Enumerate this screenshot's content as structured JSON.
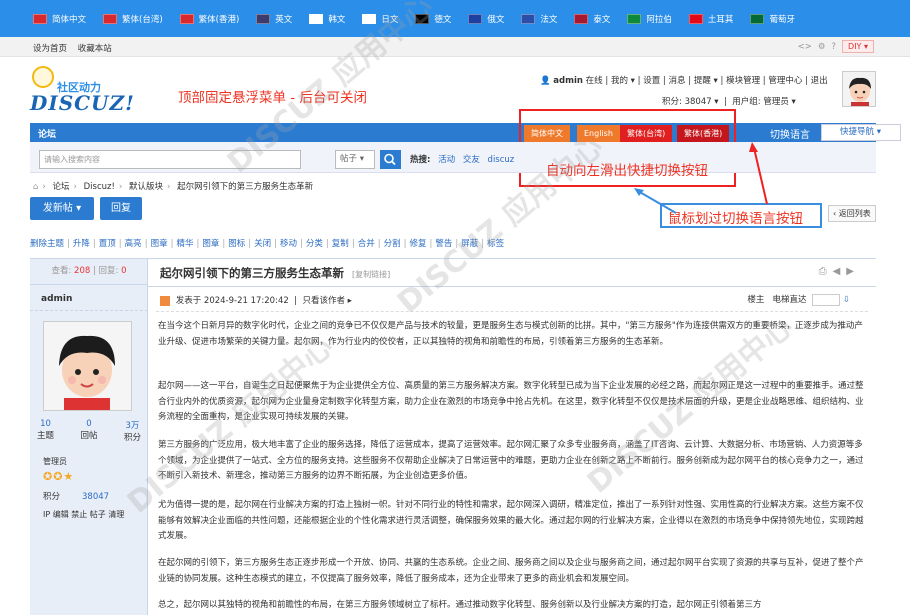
{
  "lang_bar": {
    "items": [
      {
        "label": "简体中文",
        "flag": "#d8292f"
      },
      {
        "label": "繁体(台湾)",
        "flag": "#d8292f"
      },
      {
        "label": "繁体(香港)",
        "flag": "#d8292f"
      },
      {
        "label": "英文",
        "flag": "#3c3b6e"
      },
      {
        "label": "韩文",
        "flag": "#ffffff"
      },
      {
        "label": "日文",
        "flag": "#ffffff"
      },
      {
        "label": "德文",
        "flag": "#000000"
      },
      {
        "label": "俄文",
        "flag": "#1c3fa0"
      },
      {
        "label": "法文",
        "flag": "#2b4fa8"
      },
      {
        "label": "泰文",
        "flag": "#a51931"
      },
      {
        "label": "阿拉伯",
        "flag": "#0f8a3c"
      },
      {
        "label": "土耳其",
        "flag": "#e30a17"
      },
      {
        "label": "葡萄牙",
        "flag": "#046a38"
      }
    ]
  },
  "top_links": {
    "home": "设为首页",
    "favorite": "收藏本站",
    "diy": "DIY"
  },
  "logo": {
    "cn": "社区动力",
    "en": "DISCUZ!"
  },
  "annotations": {
    "fixed_menu": "顶部固定悬浮菜单 - 后台可关闭",
    "slide": "自动向左滑出快捷切换按钮",
    "hover": "鼠标划过切换语言按钮"
  },
  "user": {
    "name": "admin",
    "status": "在线",
    "links": [
      "我的",
      "设置",
      "消息",
      "提醒",
      "模块管理",
      "管理中心",
      "退出"
    ],
    "points_label": "积分: 38047",
    "group_label": "用户组: 管理员"
  },
  "nav": {
    "forum": "论坛",
    "lang_buttons": [
      {
        "label": "简体中文",
        "color": "#f07a2b"
      },
      {
        "label": "English",
        "color": "#f07a2b"
      },
      {
        "label": "繁体(台湾)",
        "color": "#e02020"
      },
      {
        "label": "繁体(香港)",
        "color": "#c4161c"
      }
    ],
    "switch_label": "切换语言",
    "quick_nav": "快捷导航"
  },
  "search": {
    "placeholder": "请输入搜索内容",
    "type": "帖子",
    "hot_label": "热搜:",
    "hot_terms": [
      "活动",
      "交友",
      "discuz"
    ]
  },
  "breadcrumb": [
    "论坛",
    "Discuz!",
    "默认版块",
    "起尔网引领下的第三方服务生态革新"
  ],
  "actions": {
    "new_post": "发新帖",
    "reply": "回复",
    "back_list": "返回列表"
  },
  "admin_tools": [
    "删除主题",
    "升降",
    "置顶",
    "高亮",
    "图章",
    "精华",
    "图章",
    "图标",
    "关闭",
    "移动",
    "分类",
    "复制",
    "合并",
    "分割",
    "修复",
    "警告",
    "屏蔽",
    "标签"
  ],
  "thread": {
    "views_label": "查看:",
    "views": "208",
    "replies_label": "回复:",
    "replies": "0",
    "title": "起尔网引领下的第三方服务生态革新",
    "copy_link": "[复制链接]",
    "posted": "发表于 2024-9-21 17:20:42",
    "only_author": "只看该作者",
    "floor": "楼主",
    "goto_floor": "电梯直达"
  },
  "author": {
    "name": "admin",
    "stats": [
      {
        "v": "10",
        "l": "主题"
      },
      {
        "v": "0",
        "l": "回帖"
      },
      {
        "v": "3万",
        "l": "积分"
      }
    ],
    "role": "管理员",
    "points_label": "积分",
    "points": "38047",
    "links": "IP 编辑 禁止 帖子 清理"
  },
  "paragraphs": [
    "在当今这个日新月异的数字化时代，企业之间的竞争已不仅仅是产品与技术的较量，更是服务生态与模式创新的比拼。其中，\"第三方服务\"作为连接供需双方的重要桥梁，正逐步成为推动产业升级、促进市场繁荣的关键力量。起尔网，作为行业内的佼佼者，正以其独特的视角和前瞻性的布局，引领着第三方服务的生态革新。",
    "起尔网——这一平台，自诞生之日起便聚焦于为企业提供全方位、高质量的第三方服务解决方案。数字化转型已成为当下企业发展的必经之路，而起尔网正是这一过程中的重要推手。通过整合行业内外的优质资源，起尔网为企业量身定制数字化转型方案，助力企业在激烈的市场竞争中抢占先机。在这里，数字化转型不仅仅是技术层面的升级，更是企业战略思维、组织结构、业务流程的全面重构，是企业实现可持续发展的关键。",
    "第三方服务的广泛应用，极大地丰富了企业的服务选择，降低了运营成本，提高了运营效率。起尔网汇聚了众多专业服务商，涵盖了IT咨询、云计算、大数据分析、市场营销、人力资源等多个领域，为企业提供了一站式、全方位的服务支持。这些服务不仅帮助企业解决了日常运营中的难题，更助力企业在创新之路上不断前行。服务创新成为起尔网平台的核心竞争力之一，通过不断引入新技术、新理念，推动第三方服务的边界不断拓展，为企业创造更多价值。",
    "尤为值得一提的是，起尔网在行业解决方案的打造上独树一帜。针对不同行业的特性和需求，起尔网深入调研，精准定位，推出了一系列针对性强、实用性高的行业解决方案。这些方案不仅能够有效解决企业面临的共性问题，还能根据企业的个性化需求进行灵活调整，确保服务效果的最大化。通过起尔网的行业解决方案，企业得以在激烈的市场竞争中保持领先地位，实现跨越式发展。",
    "在起尔网的引领下，第三方服务生态正逐步形成一个开放、协同、共赢的生态系统。企业之间、服务商之间以及企业与服务商之间，通过起尔网平台实现了资源的共享与互补，促进了整个产业链的协同发展。这种生态模式的建立，不仅提高了服务效率，降低了服务成本，还为企业带来了更多的商业机会和发展空间。",
    "总之，起尔网以其独特的视角和前瞻性的布局，在第三方服务领域树立了标杆。通过推动数字化转型、服务创新以及行业解决方案的打造，起尔网正引领着第三方"
  ],
  "watermark": "DISCUZ 应用中心"
}
